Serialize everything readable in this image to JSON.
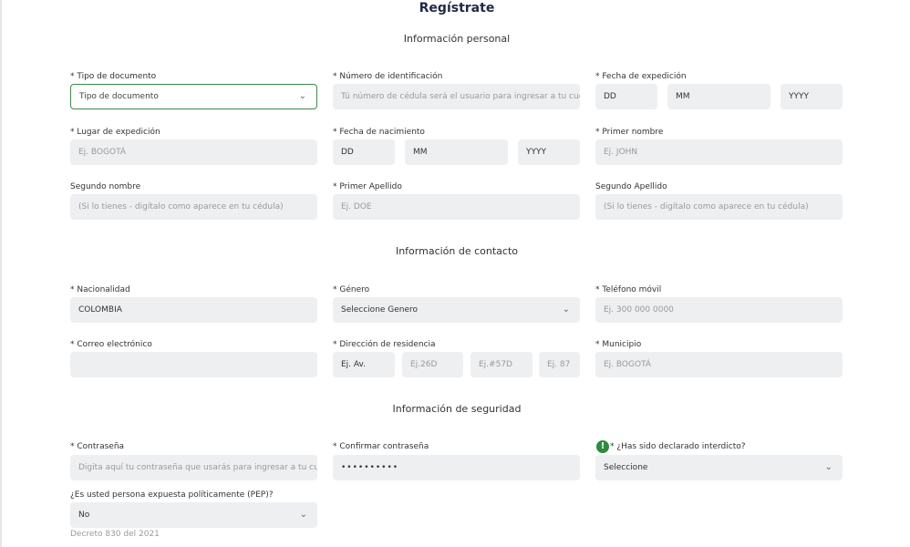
{
  "title": "Regístrate",
  "sections": {
    "personal": "Información personal",
    "contact": "Información de contacto",
    "security": "Información de seguridad"
  },
  "fields": {
    "doc_type": {
      "label": "* Tipo de documento",
      "value": "Tipo de documento"
    },
    "id_number": {
      "label": "* Número de identificación",
      "placeholder": "Tú número de cédula será el usuario para ingresar a tu cuenta"
    },
    "issue_date": {
      "label": "* Fecha de expedición",
      "day": "DD",
      "month": "MM",
      "year": "YYYY"
    },
    "issue_place": {
      "label": "* Lugar de expedición",
      "placeholder": "Ej. BOGOTÁ"
    },
    "birth_date": {
      "label": "* Fecha de nacimiento",
      "day": "DD",
      "month": "MM",
      "year": "YYYY"
    },
    "first_name": {
      "label": "* Primer nombre",
      "placeholder": "Ej. JOHN"
    },
    "second_name": {
      "label": "Segundo nombre",
      "placeholder": "(Si lo tienes - digítalo como aparece en tu cédula)"
    },
    "first_surname": {
      "label": "* Primer Apellido",
      "placeholder": "Ej. DOE"
    },
    "second_surname": {
      "label": "Segundo Apellido",
      "placeholder": "(Si lo tienes - digítalo como aparece en tu cédula)"
    },
    "nationality": {
      "label": "* Nacionalidad",
      "value": "COLOMBIA"
    },
    "gender": {
      "label": "* Género",
      "value": "Seleccione Genero"
    },
    "mobile": {
      "label": "* Teléfono móvil",
      "placeholder": "Ej. 300 000 0000"
    },
    "email": {
      "label": "* Correo electrónico",
      "placeholder": ""
    },
    "address": {
      "label": "* Dirección de residencia",
      "p1": "Ej. Av.",
      "p2": "Ej.26D",
      "p3": "Ej.#57D",
      "p4": "Ej. 87"
    },
    "municipality": {
      "label": "* Municipio",
      "placeholder": "Ej. BOGOTÁ"
    },
    "password": {
      "label": "* Contraseña",
      "placeholder": "Digita aquí tu contraseña que usarás para ingresar a tu cuenta"
    },
    "confirm_password": {
      "label": "* Confirmar contraseña",
      "value": "••••••••••"
    },
    "interdicto": {
      "label": "* ¿Has sido declarado interdicto?",
      "value": "Seleccione",
      "icon": "!"
    },
    "pep": {
      "label": "¿Es usted persona expuesta políticamente (PEP)?",
      "value": "No",
      "note": "Decreto 830 del 2021"
    }
  },
  "icons": {
    "chevron": "⌄"
  },
  "colors": {
    "accent": "#3c8a4b",
    "field_bg": "#eeeff1",
    "warn": "#2e8b3e",
    "title": "#1f2a44"
  }
}
